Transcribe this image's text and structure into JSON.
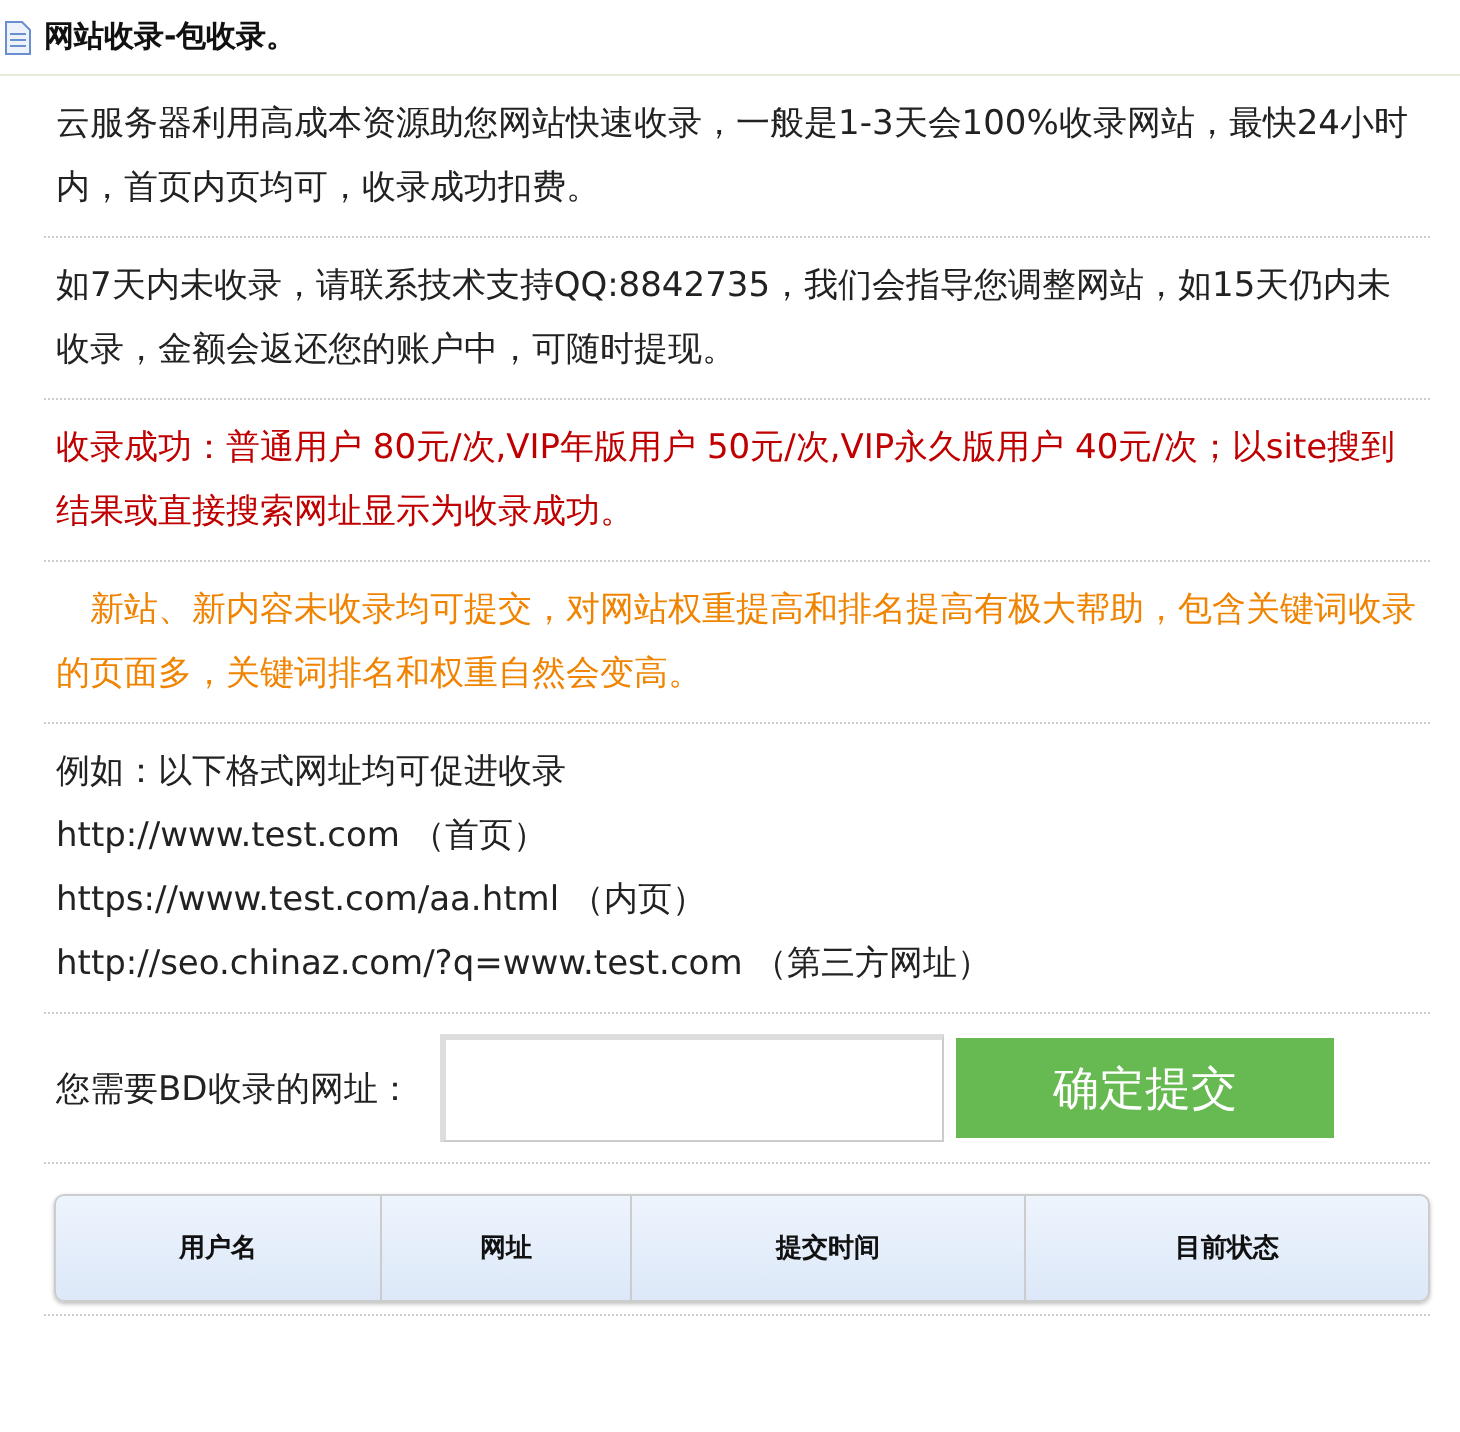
{
  "header": {
    "title": "网站收录-包收录。"
  },
  "notices": [
    {
      "kind": "normal",
      "text": "云服务器利用高成本资源助您网站快速收录，一般是1-3天会100%收录网站，最快24小时内，首页内页均可，收录成功扣费。"
    },
    {
      "kind": "normal",
      "text": "如7天内未收录，请联系技术支持QQ:8842735，我们会指导您调整网站，如15天仍内未收录，金额会返还您的账户中，可随时提现。"
    },
    {
      "kind": "warning",
      "text": "收录成功：普通用户 80元/次,VIP年版用户 50元/次,VIP永久版用户 40元/次；以site搜到结果或直接搜索网址显示为收录成功。"
    },
    {
      "kind": "highlight",
      "text": "　新站、新内容未收录均可提交，对网站权重提高和排名提高有极大帮助，包含关键词收录的页面多，关键词排名和权重自然会变高。"
    }
  ],
  "examples": [
    "例如：以下格式网址均可促进收录",
    "http://www.test.com （首页）",
    "https://www.test.com/aa.html （内页）",
    "http://seo.chinaz.com/?q=www.test.com （第三方网址）"
  ],
  "form": {
    "label": "您需要BD收录的网址：",
    "button": "确定提交"
  },
  "table": {
    "columns": [
      "用户名",
      "网址",
      "提交时间",
      "目前状态"
    ]
  }
}
